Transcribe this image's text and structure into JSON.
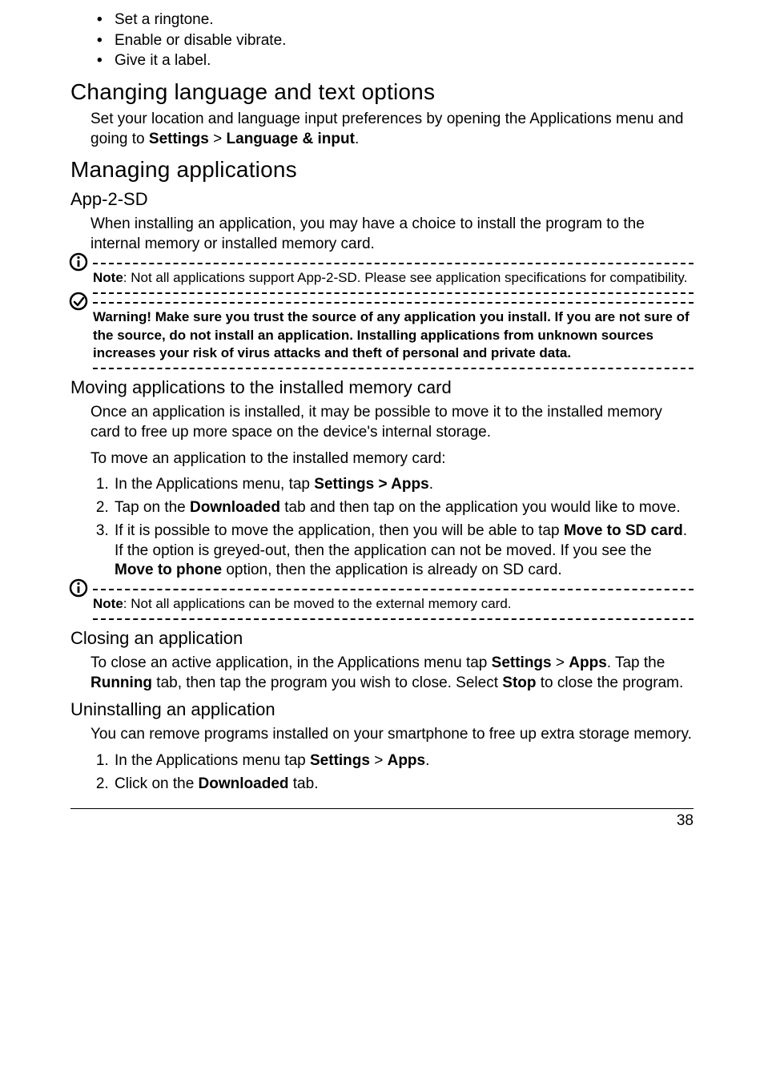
{
  "intro_bullets": [
    "Set a ringtone.",
    "Enable or disable vibrate.",
    "Give it a label."
  ],
  "h_lang": "Changing language and text options",
  "p_lang_pre": "Set your location and language input preferences by opening the Applications menu and going to ",
  "p_lang_b1": "Settings",
  "p_lang_gt": " > ",
  "p_lang_b2": "Language & input",
  "p_lang_post": ".",
  "h_manage": "Managing applications",
  "h_app2sd": "App-2-SD",
  "p_app2sd": "When installing an application, you may have a choice to install the program to the internal memory or installed memory card.",
  "note1_b": "Note",
  "note1_text": ": Not all applications support App-2-SD. Please see application specifications for compatibility.",
  "warn_text": "Warning! Make sure you trust the source of any application you install. If you are not sure of the source, do not install an application. Installing applications from unknown sources increases your risk of virus attacks and theft of personal and private data.",
  "h_moving": "Moving applications to the installed memory card",
  "p_moving1": "Once an application is installed, it may be possible to move it to the installed memory card to free up more space on the device's internal storage.",
  "p_moving2": "To move an application to the installed memory card:",
  "ol_move": {
    "i1_pre": "In the Applications menu, tap ",
    "i1_b": "Settings > Apps",
    "i1_post": ".",
    "i2_pre": "Tap on the ",
    "i2_b": "Downloaded",
    "i2_post": " tab and then tap on the application you would like to move.",
    "i3_pre": "If it is possible to move the application, then you will be able to tap ",
    "i3_b1": "Move to SD card",
    "i3_mid": ". If the option is greyed-out, then the application can not be moved. If you see the ",
    "i3_b2": "Move to phone",
    "i3_post": " option, then the application is already on SD card."
  },
  "note2_b": "Note",
  "note2_text": ": Not all applications can be moved to the external memory card.",
  "h_closing": "Closing an application",
  "p_close_pre": "To close an active application, in the Applications menu tap ",
  "p_close_b1": "Settings",
  "p_close_gt": " > ",
  "p_close_b2": "Apps",
  "p_close_mid1": ". Tap the ",
  "p_close_b3": "Running",
  "p_close_mid2": " tab, then tap the program you wish to close. Select ",
  "p_close_b4": "Stop",
  "p_close_post": " to close the program.",
  "h_uninstall": "Uninstalling an application",
  "p_uninstall": "You can remove programs installed on your smartphone to free up extra storage memory.",
  "ol_uninst": {
    "i1_pre": "In the Applications menu tap ",
    "i1_b1": "Settings",
    "i1_gt": " > ",
    "i1_b2": "Apps",
    "i1_post": ".",
    "i2_pre": "Click on the ",
    "i2_b": "Downloaded",
    "i2_post": " tab."
  },
  "page_number": "38"
}
